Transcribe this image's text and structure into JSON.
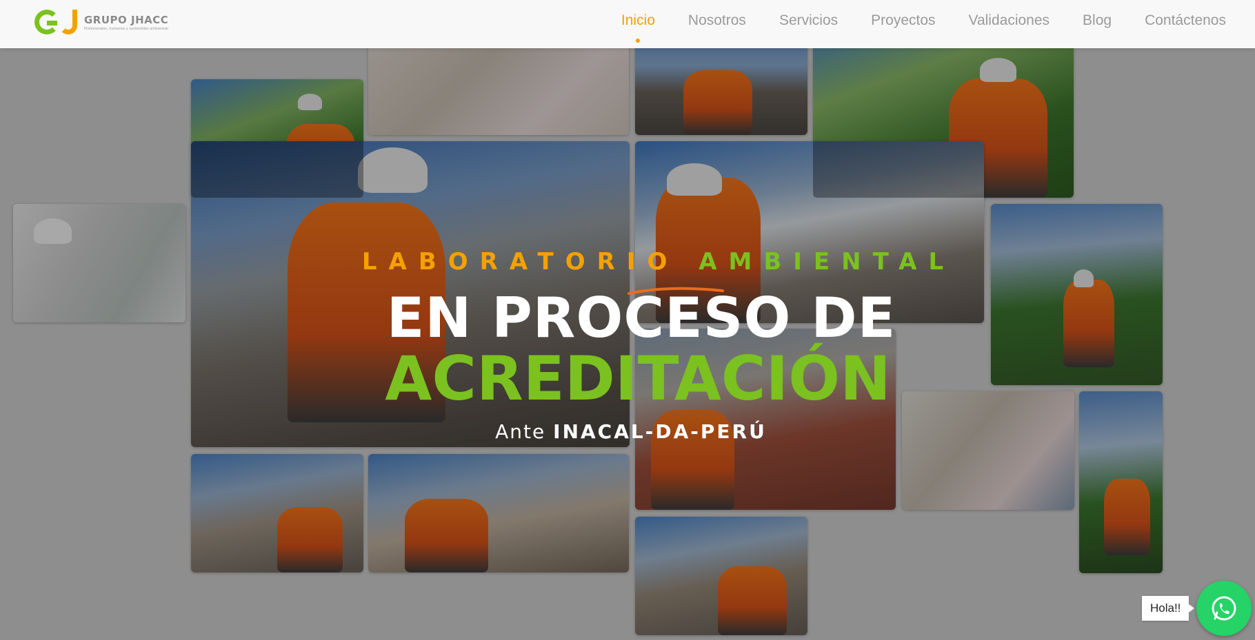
{
  "brand": {
    "name": "GRUPO JHACC",
    "tagline": "Profesionales, humanos y sostenibles ambientales"
  },
  "nav": {
    "items": [
      {
        "label": "Inicio",
        "active": true
      },
      {
        "label": "Nosotros",
        "active": false
      },
      {
        "label": "Servicios",
        "active": false
      },
      {
        "label": "Proyectos",
        "active": false
      },
      {
        "label": "Validaciones",
        "active": false
      },
      {
        "label": "Blog",
        "active": false
      },
      {
        "label": "Contáctenos",
        "active": false
      }
    ]
  },
  "hero": {
    "subtitle_part1": "LABORATORIO",
    "subtitle_part2": "AMBIENTAL",
    "line1": "EN PROCESO DE",
    "line2": "ACREDITACIÓN",
    "ante_prefix": "Ante",
    "ante_entity": "INACAL-DA-PERÚ"
  },
  "chat": {
    "greeting": "Hola!!"
  },
  "colors": {
    "orange": "#f5a100",
    "green": "#7bc11f",
    "whatsapp": "#25d366"
  }
}
